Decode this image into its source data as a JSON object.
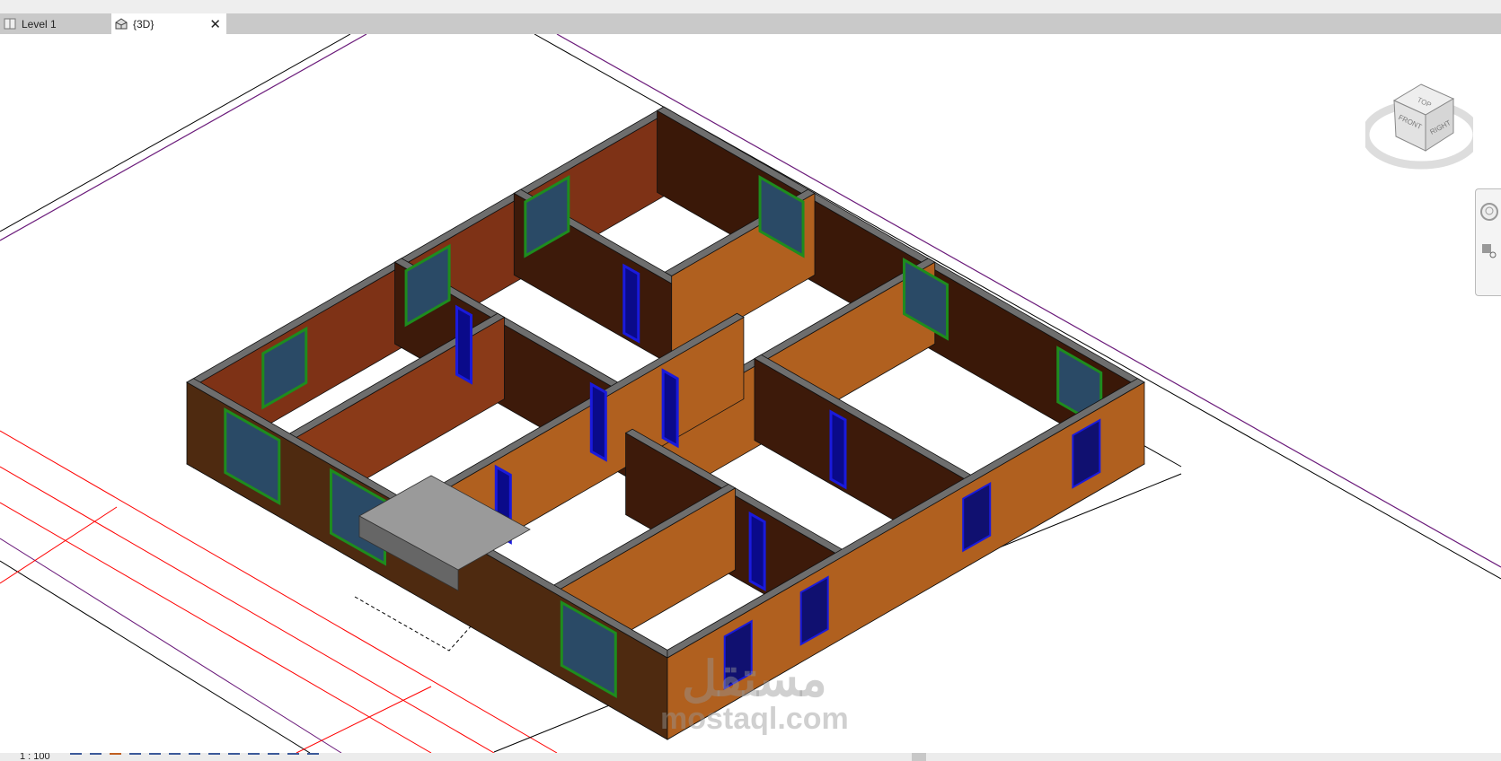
{
  "tabs": [
    {
      "label": "Level 1",
      "icon": "floor-plan-icon",
      "active": false
    },
    {
      "label": "{3D}",
      "icon": "3d-house-icon",
      "active": true,
      "close": "✕"
    }
  ],
  "viewcube": {
    "top": "TOP",
    "front": "FRONT",
    "right": "RIGHT"
  },
  "status": {
    "scale": "1 : 100"
  },
  "watermark": {
    "arabic": "مستقل",
    "latin": "mostaql.com"
  },
  "colors": {
    "wall_orange": "#b0601f",
    "wall_dark": "#4e2a10",
    "wall_maroon": "#7e3216",
    "wall_cap": "#6e6e6e",
    "window_green": "#1e8c1e",
    "door_blue": "#1a1adc",
    "purple_line": "#6a1a7a",
    "red_line": "#ff0000"
  }
}
